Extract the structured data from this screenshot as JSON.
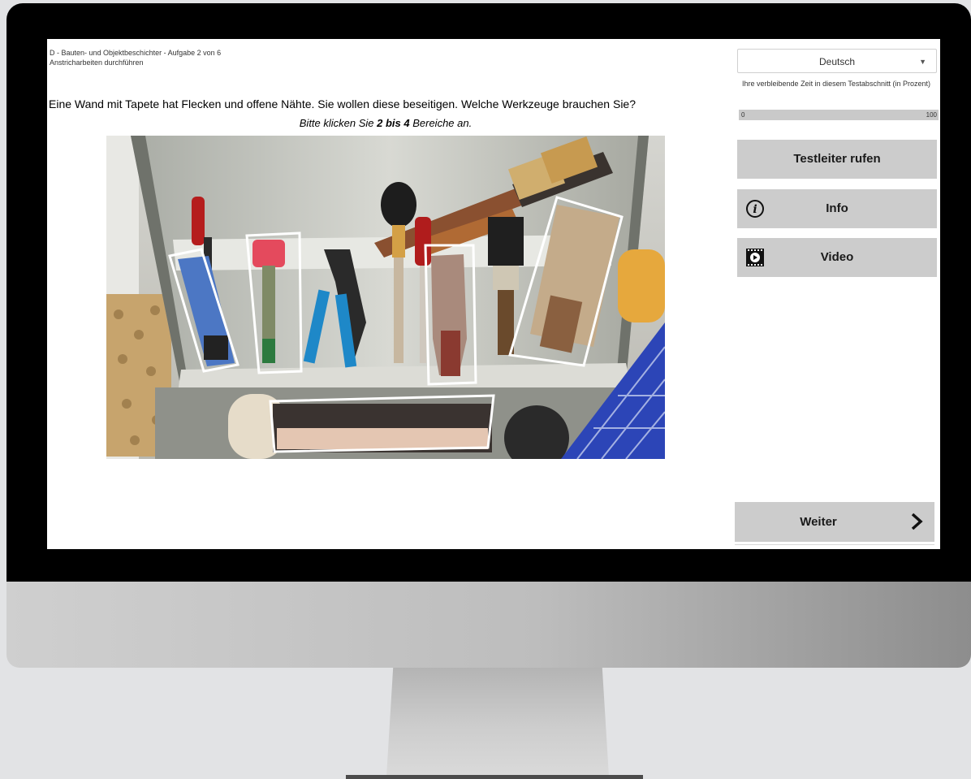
{
  "header": {
    "breadcrumb_line1": "D - Bauten- und Objektbeschichter - Aufgabe 2 von 6",
    "breadcrumb_line2": "Anstricharbeiten durchführen"
  },
  "question": {
    "text": "Eine Wand mit Tapete hat Flecken und offene Nähte. Sie wollen diese beseitigen. Welche Werkzeuge brauchen Sie?",
    "instruction_pre": "Bitte klicken Sie ",
    "instruction_bold": "2 bis 4",
    "instruction_post": " Bereiche an."
  },
  "image": {
    "selectable_regions": [
      "spachtel-klein",
      "tapeziererrolle",
      "spachtel",
      "flachpinsel",
      "buerste"
    ]
  },
  "sidebar": {
    "language_selected": "Deutsch",
    "time_label": "Ihre verbleibende Zeit in diesem Testabschnitt (in Prozent)",
    "time_min": "0",
    "time_max": "100",
    "time_remaining_percent": 100,
    "call_button": "Testleiter rufen",
    "info_button": "Info",
    "video_button": "Video",
    "next_button": "Weiter"
  },
  "icons": {
    "language_dropdown": "chevron-down-icon",
    "info": "info-icon",
    "video": "video-icon",
    "next": "chevron-right-icon"
  },
  "colors": {
    "button_bg": "#cccccc",
    "progress_bg": "#c9c9c9",
    "bezel": "#000000",
    "region_outline": "#ffffff"
  }
}
